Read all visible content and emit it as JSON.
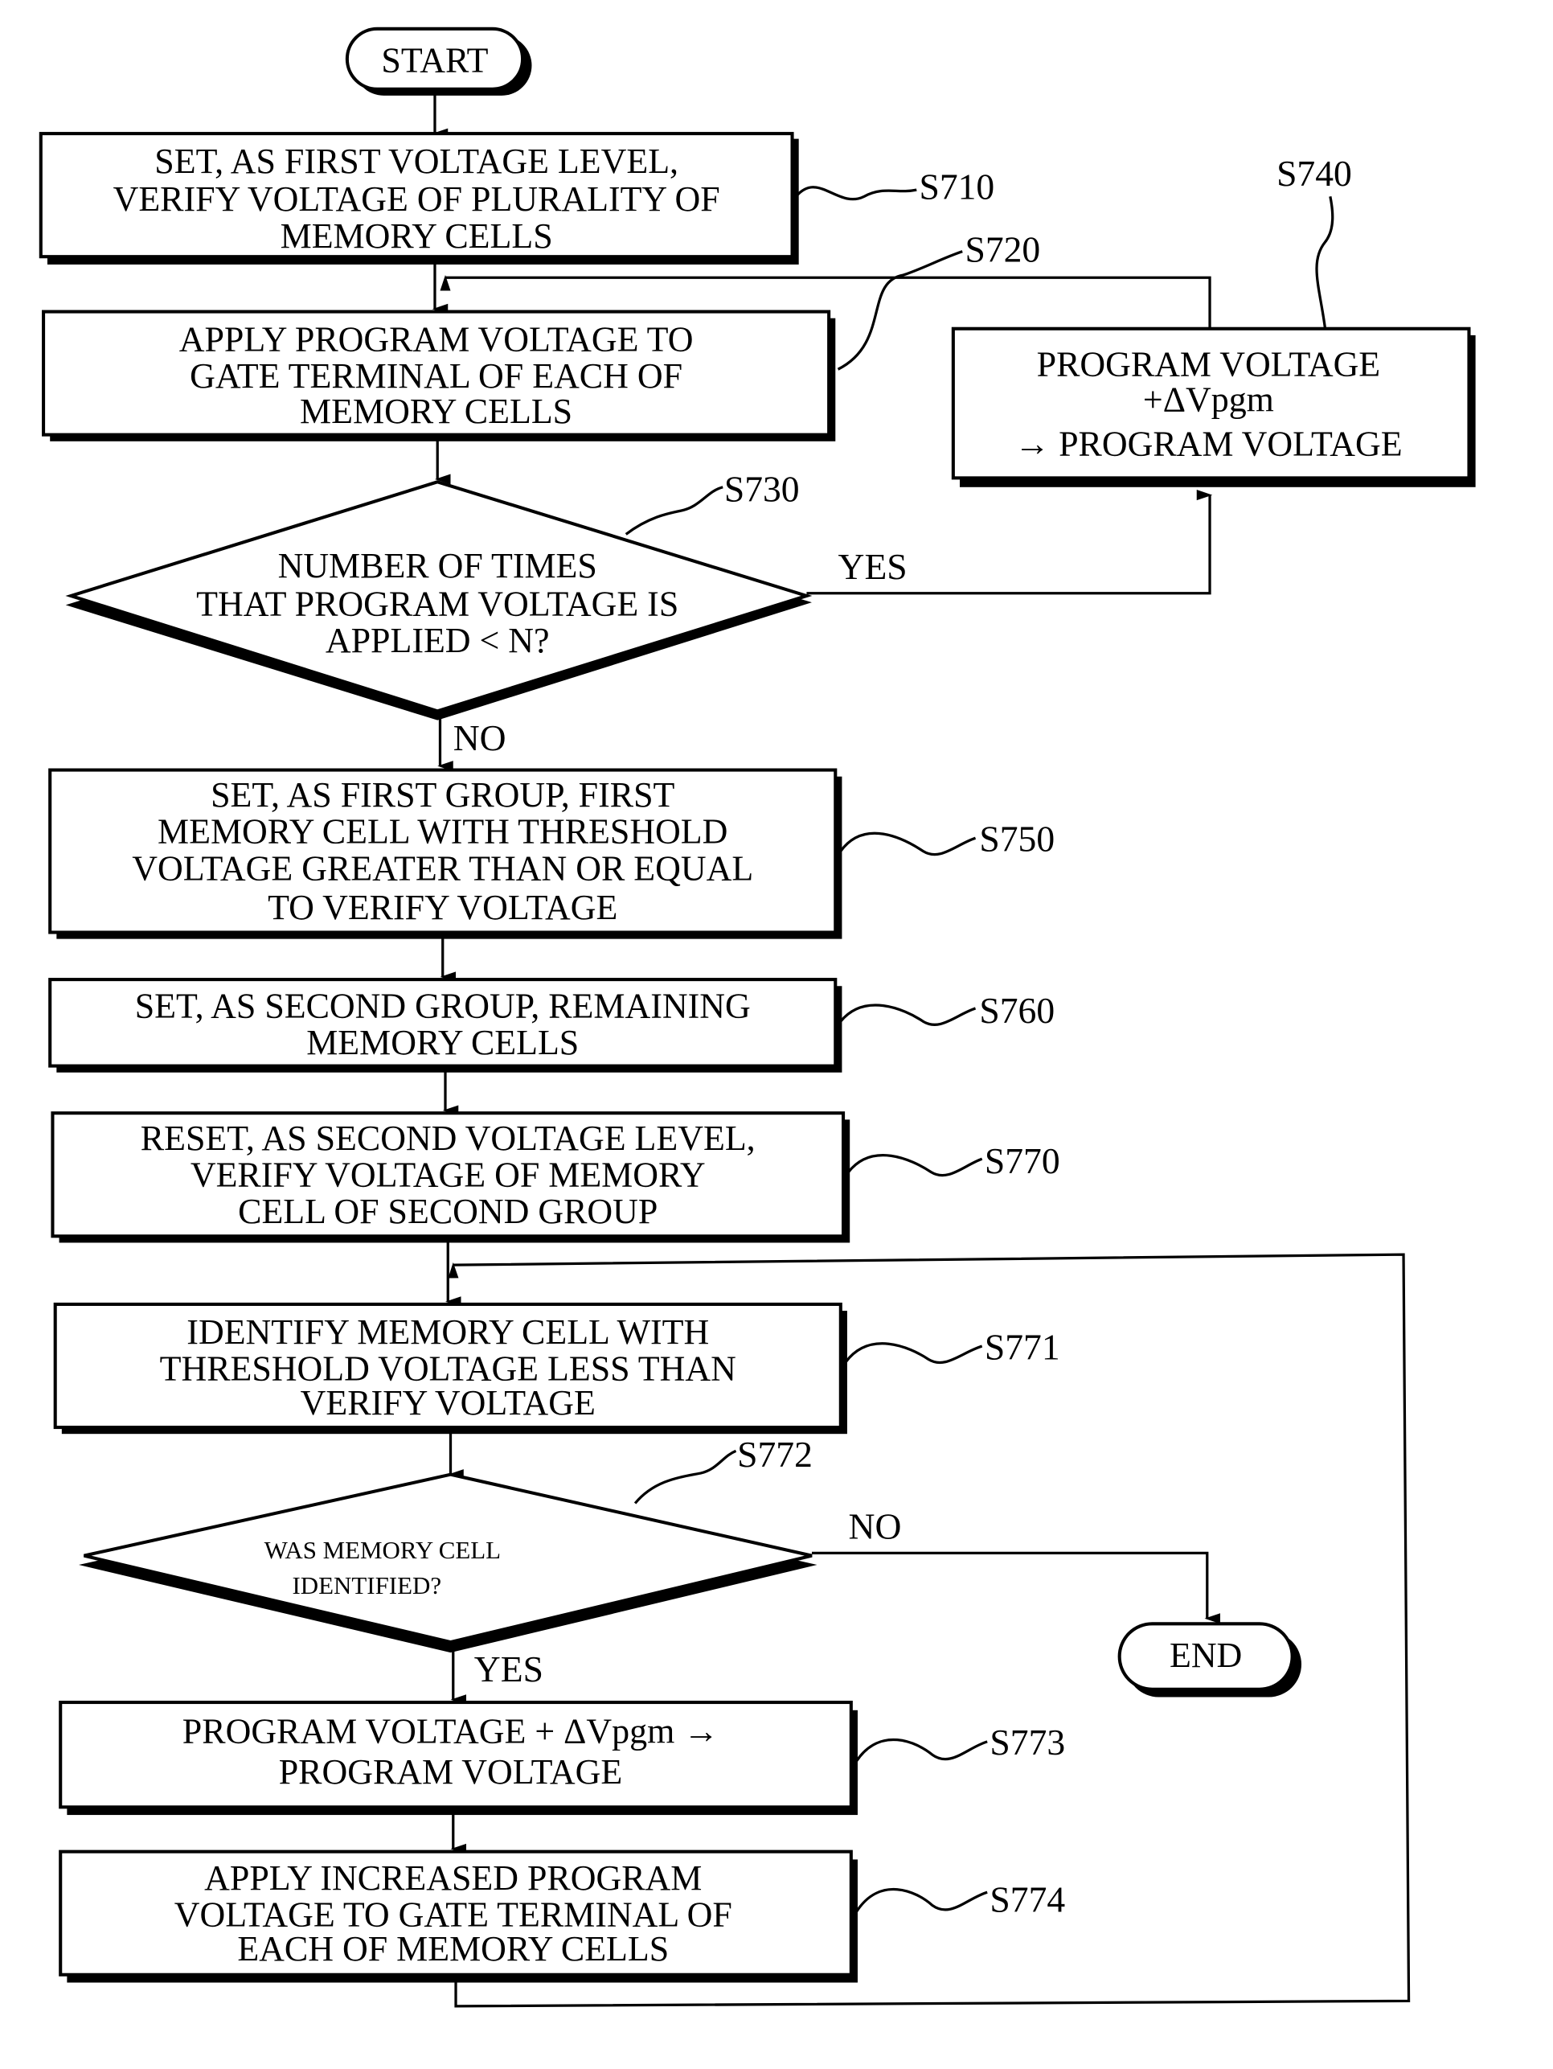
{
  "flowchart": {
    "start": "START",
    "end": "END",
    "steps": {
      "s710": {
        "id": "S710",
        "lines": [
          "SET, AS FIRST VOLTAGE LEVEL,",
          "VERIFY VOLTAGE OF PLURALITY OF",
          "MEMORY CELLS"
        ]
      },
      "s720": {
        "id": "S720",
        "lines": [
          "APPLY PROGRAM VOLTAGE TO",
          "GATE TERMINAL OF EACH OF",
          "MEMORY CELLS"
        ]
      },
      "s730": {
        "id": "S730",
        "lines": [
          "NUMBER OF TIMES",
          "THAT PROGRAM VOLTAGE IS",
          "APPLIED < N?"
        ]
      },
      "s740": {
        "id": "S740",
        "lines": [
          "PROGRAM VOLTAGE",
          "+ΔVpgm",
          "→ PROGRAM VOLTAGE"
        ]
      },
      "s750": {
        "id": "S750",
        "lines": [
          "SET, AS FIRST GROUP, FIRST",
          "MEMORY CELL WITH THRESHOLD",
          "VOLTAGE GREATER THAN OR EQUAL",
          "TO VERIFY VOLTAGE"
        ]
      },
      "s760": {
        "id": "S760",
        "lines": [
          "SET, AS SECOND GROUP, REMAINING",
          "MEMORY CELLS"
        ]
      },
      "s770": {
        "id": "S770",
        "lines": [
          "RESET, AS SECOND VOLTAGE LEVEL,",
          "VERIFY VOLTAGE OF MEMORY",
          "CELL OF SECOND GROUP"
        ]
      },
      "s771": {
        "id": "S771",
        "lines": [
          "IDENTIFY MEMORY CELL WITH",
          "THRESHOLD VOLTAGE LESS THAN",
          "VERIFY VOLTAGE"
        ]
      },
      "s772": {
        "id": "S772",
        "lines": [
          "WAS MEMORY CELL",
          "IDENTIFIED?"
        ]
      },
      "s773": {
        "id": "S773",
        "lines": [
          "PROGRAM VOLTAGE + ΔVpgm →",
          "PROGRAM VOLTAGE"
        ]
      },
      "s774": {
        "id": "S774",
        "lines": [
          "APPLY INCREASED PROGRAM",
          "VOLTAGE TO GATE TERMINAL OF",
          "EACH OF MEMORY CELLS"
        ]
      }
    },
    "branches": {
      "s730_yes": "YES",
      "s730_no": "NO",
      "s772_yes": "YES",
      "s772_no": "NO"
    }
  }
}
